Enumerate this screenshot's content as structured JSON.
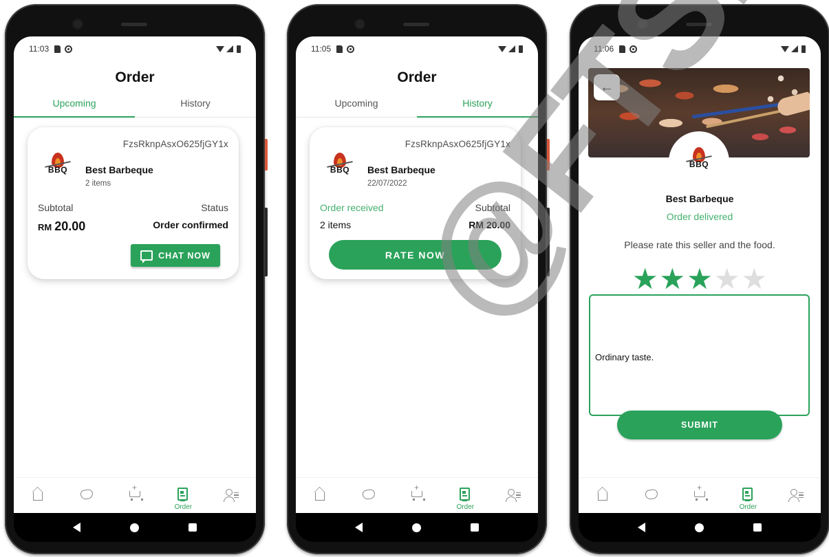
{
  "screens": [
    {
      "status": {
        "time": "11:03"
      },
      "title": "Order",
      "tabs": [
        {
          "label": "Upcoming",
          "active": true
        },
        {
          "label": "History",
          "active": false
        }
      ],
      "order": {
        "id": "FzsRknpAsxO625fjGY1x",
        "shop_name": "Best Barbeque",
        "shop_sub": "2 items",
        "left_label": "Subtotal",
        "right_label": "Status",
        "currency": "RM",
        "amount": "20.00",
        "status_value": "Order confirmed",
        "button_label": "CHAT NOW"
      }
    },
    {
      "status": {
        "time": "11:05"
      },
      "title": "Order",
      "tabs": [
        {
          "label": "Upcoming",
          "active": false
        },
        {
          "label": "History",
          "active": true
        }
      ],
      "order": {
        "id": "FzsRknpAsxO625fjGY1x",
        "shop_name": "Best Barbeque",
        "shop_sub": "22/07/2022",
        "left_label": "Order received",
        "right_label": "Subtotal",
        "items_value": "2 items",
        "amount_value": "RM 20.00",
        "button_label": "RATE NOW"
      }
    },
    {
      "status": {
        "time": "11:06"
      },
      "shop_name": "Best Barbeque",
      "status_text": "Order delivered",
      "prompt": "Please rate this seller and the food.",
      "rating": 3,
      "rating_max": 5,
      "review_text": "Ordinary taste.",
      "button_label": "SUBMIT"
    }
  ],
  "logo_text": "BBQ",
  "bottom_nav": [
    {
      "icon": "home-icon",
      "label": ""
    },
    {
      "icon": "heart-handshake-icon",
      "label": ""
    },
    {
      "icon": "cart-add-icon",
      "label": ""
    },
    {
      "icon": "order-icon",
      "label": "Order",
      "active": true
    },
    {
      "icon": "profile-list-icon",
      "label": ""
    }
  ],
  "watermark": "@FTSM",
  "colors": {
    "accent": "#2aa25a",
    "accent_light": "#43b06d"
  }
}
